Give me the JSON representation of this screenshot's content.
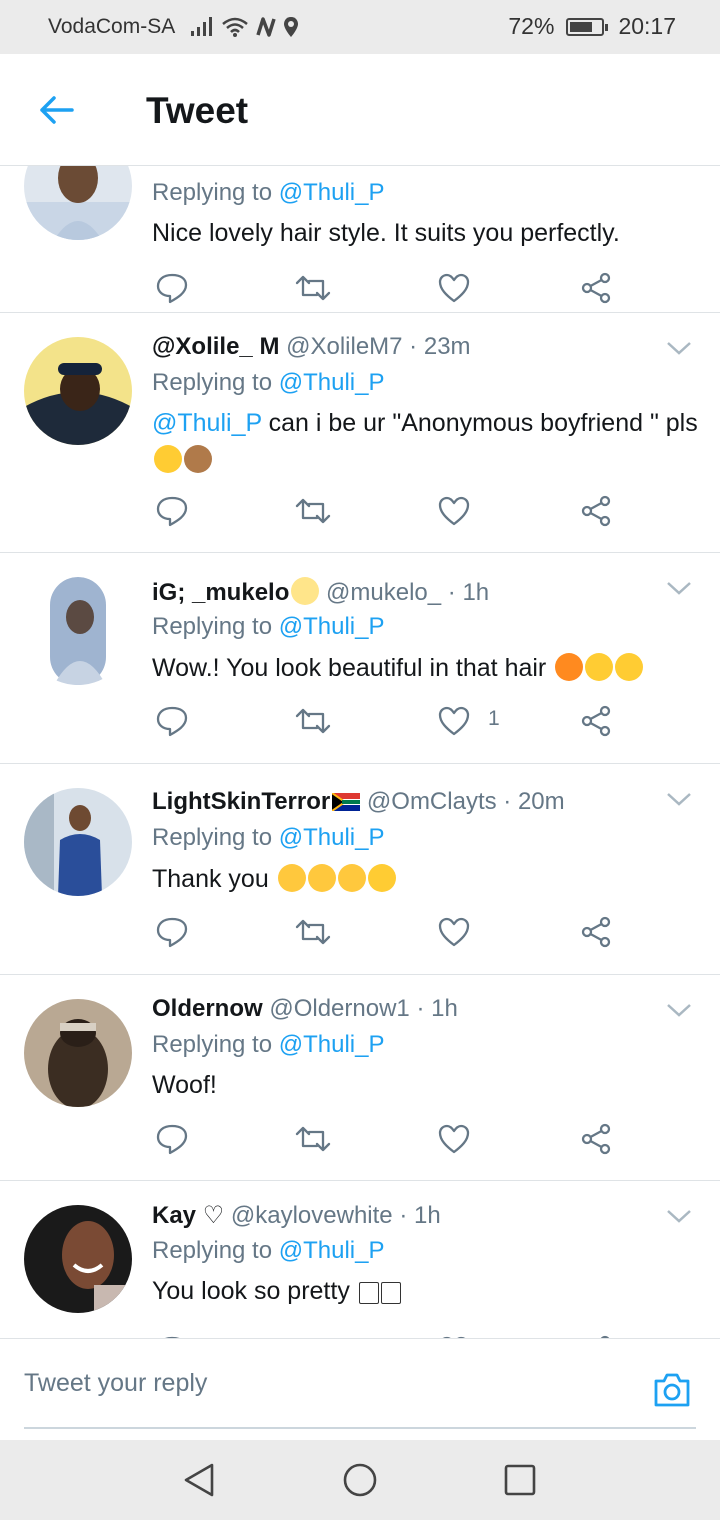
{
  "status_bar": {
    "carrier": "VodaCom-SA",
    "battery": "72%",
    "battery_level": 0.72,
    "time": "20:17"
  },
  "header": {
    "title": "Tweet"
  },
  "replying_prefix": "Replying to ",
  "tweets": [
    {
      "display_name": "",
      "handle_time": "",
      "replying_to": "@Thuli_P",
      "body": "Nice lovely hair style. It suits you perfectly.",
      "likes": "",
      "avatar_colors": [
        "#c9d6e6",
        "#8a6b55"
      ]
    },
    {
      "display_name": "@Xolile_ M",
      "handle_time": "@XolileM7 · 23m",
      "replying_to": "@Thuli_P",
      "body_mention": "@Thuli_P",
      "body": " can i be ur \"Anonymous boyfriend \" pls",
      "likes": "",
      "avatar_colors": [
        "#f3e38a",
        "#1e2a3a"
      ]
    },
    {
      "display_name": "iG; _mukelo",
      "handle_time": "@mukelo_ · 1h",
      "replying_to": "@Thuli_P",
      "body": "Wow.! You look beautiful in that hair ",
      "likes": "1",
      "avatar_colors": [
        "#9fb4d0",
        "#5b4a42"
      ]
    },
    {
      "display_name": "LightSkinTerror",
      "handle_time": "@OmClayts · 20m",
      "replying_to": "@Thuli_P",
      "body": "Thank you ",
      "likes": "",
      "avatar_colors": [
        "#a9b8c6",
        "#2a4e9a"
      ]
    },
    {
      "display_name": "Oldernow",
      "handle_time": "@Oldernow1 · 1h",
      "replying_to": "@Thuli_P",
      "body": "Woof!",
      "likes": "",
      "avatar_colors": [
        "#b9a893",
        "#3b2d22"
      ]
    },
    {
      "display_name": "Kay ♡",
      "handle_time": "@kaylovewhite · 1h",
      "replying_to": "@Thuli_P",
      "body": "You look so pretty ",
      "likes": "",
      "avatar_colors": [
        "#1a1a1a",
        "#c8b8b0"
      ]
    }
  ],
  "composer": {
    "placeholder": "Tweet your reply"
  },
  "colors": {
    "accent": "#1da1f2",
    "text": "#14171a",
    "secondary": "#657786",
    "divider": "#dfe3e6",
    "system_bar": "#ebebeb"
  },
  "icons": {
    "back": "arrow-left-icon",
    "reply": "speech-bubble-icon",
    "retweet": "retweet-arrows-icon",
    "like": "heart-icon",
    "share": "share-nodes-icon",
    "caret": "chevron-down-icon",
    "camera": "camera-icon"
  }
}
